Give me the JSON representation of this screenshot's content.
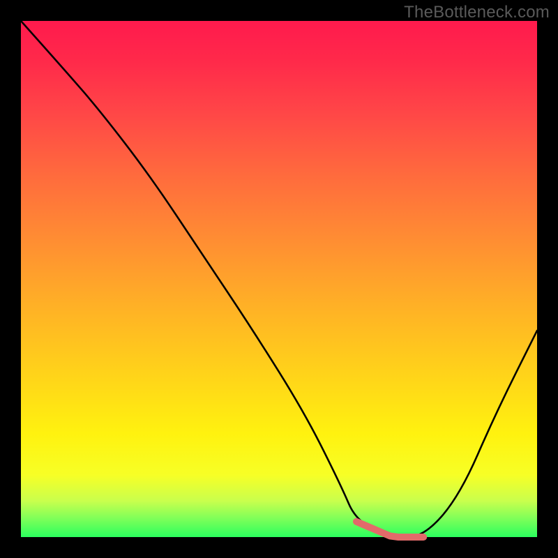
{
  "attribution": "TheBottleneck.com",
  "colors": {
    "page_bg": "#000000",
    "gradient_top": "#ff1a4d",
    "gradient_bottom": "#2bff5e",
    "curve": "#000000",
    "trough_highlight": "#e26a6a"
  },
  "chart_data": {
    "type": "line",
    "title": "",
    "xlabel": "",
    "ylabel": "",
    "xlim": [
      0,
      100
    ],
    "ylim": [
      0,
      100
    ],
    "grid": false,
    "legend": false,
    "series": [
      {
        "name": "curve",
        "x": [
          0,
          8,
          15,
          25,
          35,
          45,
          55,
          62,
          65,
          72,
          78,
          85,
          92,
          100
        ],
        "values": [
          100,
          91,
          83,
          70,
          55,
          40,
          24,
          10,
          3,
          0,
          0,
          8,
          24,
          40
        ]
      }
    ],
    "trough_x_range": [
      65,
      78
    ],
    "annotations": []
  }
}
